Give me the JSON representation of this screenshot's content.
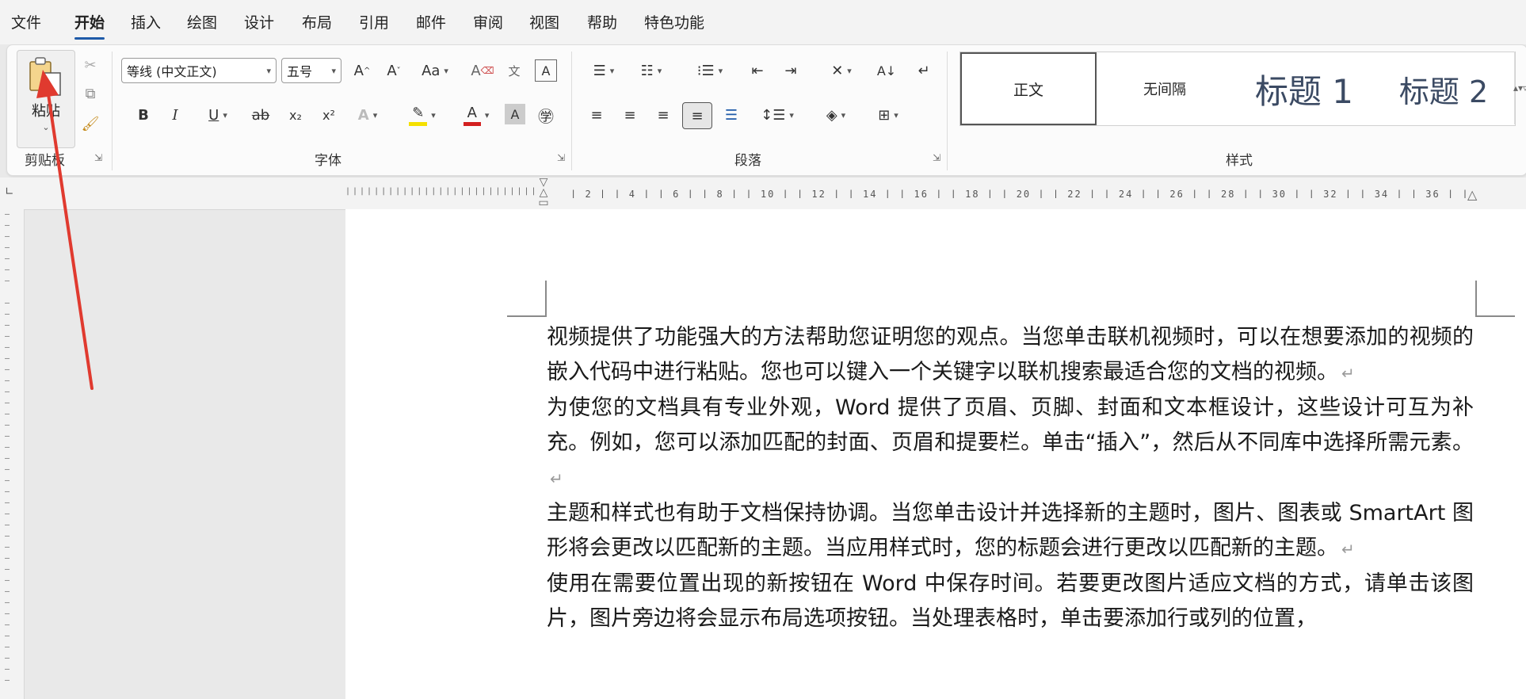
{
  "menu": {
    "tabs": [
      "文件",
      "开始",
      "插入",
      "绘图",
      "设计",
      "布局",
      "引用",
      "邮件",
      "审阅",
      "视图",
      "帮助",
      "特色功能"
    ],
    "active": "开始"
  },
  "clipboard": {
    "paste_label": "粘贴",
    "group_label": "剪贴板"
  },
  "font": {
    "font_name": "等线 (中文正文)",
    "font_size": "五号",
    "grow_label": "A^",
    "shrink_label": "A˅",
    "case_label": "Aa",
    "bold": "B",
    "italic": "I",
    "underline": "U",
    "strike": "ab",
    "subscript": "x₂",
    "superscript": "x²",
    "group_label": "字体"
  },
  "paragraph": {
    "group_label": "段落"
  },
  "styles": {
    "items": [
      "正文",
      "无间隔",
      "标题 1",
      "标题 2"
    ],
    "group_label": "样式"
  },
  "ruler": {
    "ticks": "| 2 | | 4 | | 6 | | 8 | | 10 | | 12 | | 14 | | 16 | | 18 | | 20 | | 22 | | 24 | | 26 | | 28 | | 30 | | 32 | | 34 | | 36 | | 38 |"
  },
  "document": {
    "paragraphs": [
      "视频提供了功能强大的方法帮助您证明您的观点。当您单击联机视频时，可以在想要添加的视频的嵌入代码中进行粘贴。您也可以键入一个关键字以联机搜索最适合您的文档的视频。",
      "为使您的文档具有专业外观，Word 提供了页眉、页脚、封面和文本框设计，这些设计可互为补充。例如，您可以添加匹配的封面、页眉和提要栏。单击“插入”，然后从不同库中选择所需元素。",
      "主题和样式也有助于文档保持协调。当您单击设计并选择新的主题时，图片、图表或 SmartArt 图形将会更改以匹配新的主题。当应用样式时，您的标题会进行更改以匹配新的主题。",
      "使用在需要位置出现的新按钮在 Word 中保存时间。若要更改图片适应文档的方式，请单击该图片，图片旁边将会显示布局选项按钮。当处理表格时，单击要添加行或列的位置，"
    ],
    "paragraph_mark": "↵"
  },
  "colors": {
    "accent": "#1e5aa8",
    "highlight": "#f5e000",
    "font_color": "#d32020",
    "annotation_arrow": "#e03a2f"
  }
}
